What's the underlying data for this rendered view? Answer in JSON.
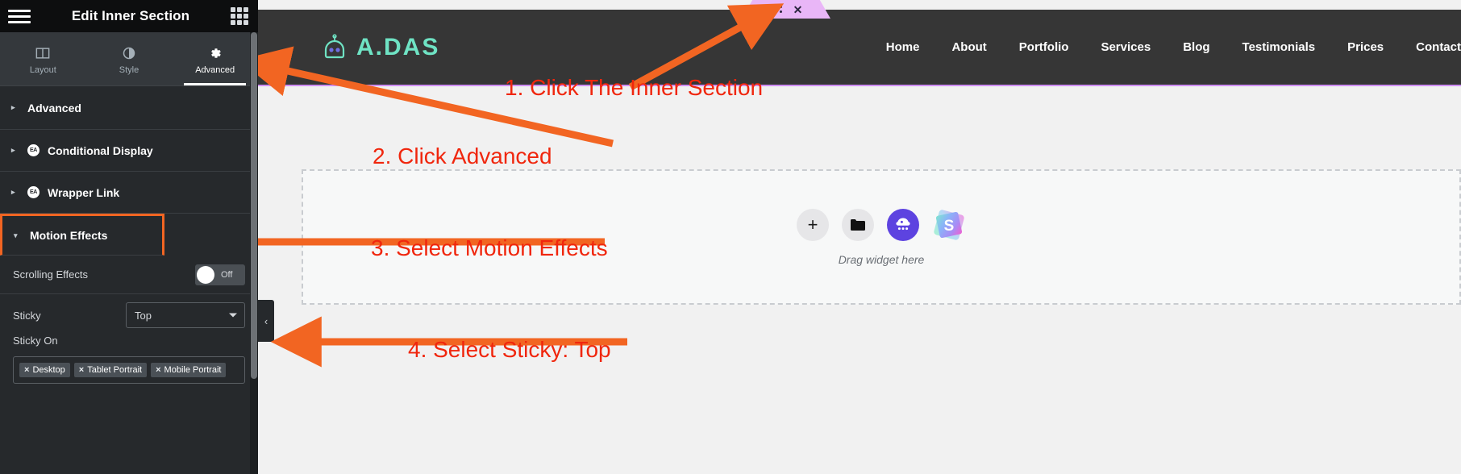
{
  "panel": {
    "title": "Edit Inner Section",
    "menu_icon": "hamburger-icon",
    "apps_icon": "apps-grid-icon",
    "tabs": [
      {
        "label": "Layout",
        "icon": "layout-columns-icon",
        "active": false
      },
      {
        "label": "Style",
        "icon": "contrast-circle-icon",
        "active": false
      },
      {
        "label": "Advanced",
        "icon": "gear-icon",
        "active": true
      }
    ],
    "sections": [
      {
        "label": "Advanced",
        "badge": null,
        "expanded": false,
        "highlighted": false
      },
      {
        "label": "Conditional Display",
        "badge": "EA",
        "expanded": false,
        "highlighted": false
      },
      {
        "label": "Wrapper Link",
        "badge": "EA",
        "expanded": false,
        "highlighted": false
      },
      {
        "label": "Motion Effects",
        "badge": null,
        "expanded": true,
        "highlighted": true
      }
    ],
    "controls": {
      "scrolling_effects_label": "Scrolling Effects",
      "scrolling_effects_value": "Off",
      "sticky_label": "Sticky",
      "sticky_value": "Top",
      "sticky_on_label": "Sticky On",
      "sticky_on_tags": [
        "Desktop",
        "Tablet Portrait",
        "Mobile Portrait"
      ],
      "tag_remove_glyph": "×"
    }
  },
  "canvas": {
    "section_handle": {
      "drag_icon": "six-dots-drag-icon",
      "close_icon": "close-x-icon"
    },
    "site": {
      "logo_text": "A.DAS",
      "logo_icon": "robot-head-icon",
      "nav_items": [
        "Home",
        "About",
        "Portfolio",
        "Services",
        "Blog",
        "Testimonials",
        "Prices",
        "Contact"
      ]
    },
    "drop_zone": {
      "hint": "Drag widget here",
      "buttons": [
        {
          "name": "add-widget-button",
          "icon": "plus-icon"
        },
        {
          "name": "open-folder-button",
          "icon": "folder-icon"
        },
        {
          "name": "ai-widget-button",
          "icon": "ai-robot-icon"
        },
        {
          "name": "s-template-button",
          "icon": "s-logo-icon"
        }
      ]
    },
    "collapse_tab_glyph": "‹"
  },
  "annotations": {
    "accent_color": "#f26522",
    "text_color": "#f0260d",
    "steps": [
      {
        "text": "1. Click The Inner Section"
      },
      {
        "text": "2. Click Advanced"
      },
      {
        "text": "3. Select Motion Effects"
      },
      {
        "text": "4. Select Sticky: Top"
      }
    ]
  },
  "theme": {
    "panel_bg": "#26292c",
    "panel_header_bg": "#0d0e0f",
    "tabs_bg": "#34383c",
    "site_header_bg": "#363636",
    "logo_green": "#6fe3c4",
    "handle_pink": "#e9b6f7",
    "ai_purple": "#5d43e0"
  }
}
